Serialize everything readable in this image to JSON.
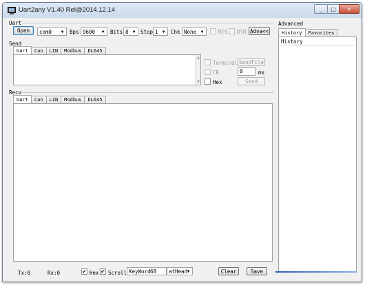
{
  "window": {
    "title": "Uart2any V1.40 Rel@2014.12.14",
    "caption_buttons": [
      "minimize",
      "maximize",
      "close"
    ]
  },
  "uart": {
    "group_label": "Uart",
    "open_button": "Open",
    "port_value": "com0",
    "bps_label": "Bps",
    "bps_value": "9600",
    "bits_label": "Bits",
    "bits_value": "8",
    "stop_label": "Stop",
    "stop_value": "1",
    "chk_label": "Chk",
    "chk_value": "None",
    "rts_label": "RTS",
    "dtr_label": "DTR",
    "adva_button": "Adva<<"
  },
  "send": {
    "group_label": "Send",
    "tabs": [
      "Uart",
      "Can",
      "LIN",
      "Modbus",
      "DL645"
    ],
    "terminal_label": "Terminal",
    "cr_label": "CR",
    "hex_label": "Hex",
    "interval_value": "0",
    "interval_unit": "ms",
    "sendfile_button": "SendFile",
    "send_button": "Send"
  },
  "recv": {
    "group_label": "Recv",
    "tabs": [
      "Uart",
      "Can",
      "LIN",
      "Modbus",
      "DL645"
    ]
  },
  "status": {
    "tx": "Tx:0",
    "rx": "Rx:0",
    "hex_label": "Hex",
    "hex_checked": true,
    "scroll_label": "Scroll",
    "scroll_checked": true,
    "keyword_label": "KeyWord",
    "keyword_value": "68",
    "athead_value": "atHead",
    "clear_button": "Clear",
    "save_button": "Save"
  },
  "advanced": {
    "group_label": "Advanced",
    "tabs": [
      "History",
      "Favorites"
    ],
    "list_header": "History"
  }
}
